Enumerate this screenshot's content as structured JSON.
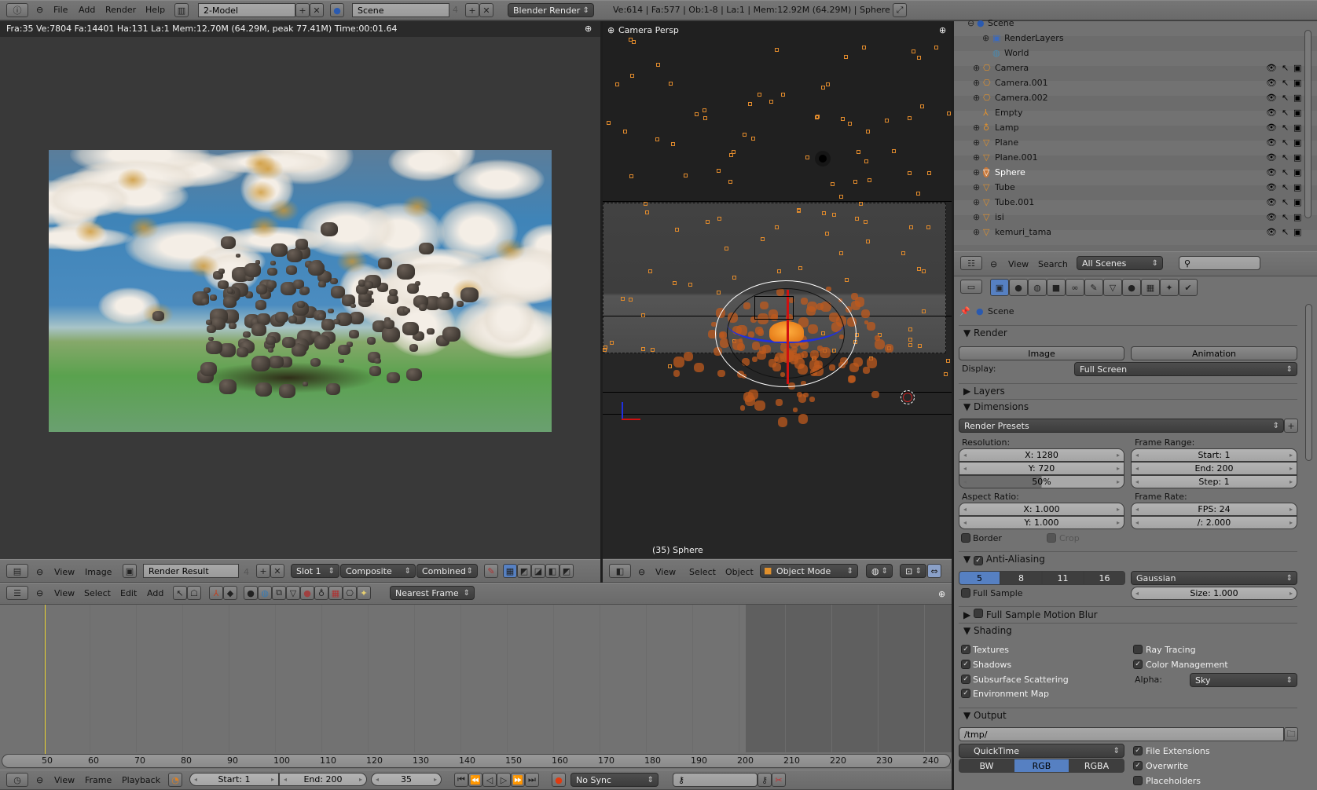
{
  "topbar": {
    "menus": [
      "File",
      "Add",
      "Render",
      "Help"
    ],
    "screen_layout": "2-Model",
    "scene": "Scene",
    "scene_users": "4",
    "engine": "Blender Render",
    "stats": "Ve:614 | Fa:577 | Ob:1-8 | La:1 | Mem:12.92M (64.29M) | Sphere"
  },
  "image_editor": {
    "info": "Fra:35  Ve:7804 Fa:14401 Ha:131 La:1 Mem:12.70M (64.29M, peak 77.41M) Time:00:01.64",
    "header": {
      "menus": [
        "View",
        "Image"
      ],
      "image_name": "Render Result",
      "image_users": "4",
      "slot": "Slot 1",
      "layer": "Composite",
      "pass": "Combined"
    }
  },
  "viewport": {
    "label": "Camera Persp",
    "object_label": "(35) Sphere",
    "header": {
      "menus": [
        "View",
        "Select",
        "Object"
      ],
      "mode": "Object Mode"
    },
    "colors": {
      "particle": "#e08a2c",
      "x_axis": "#d01010",
      "z_axis": "#2030e0"
    }
  },
  "outliner": {
    "items": [
      {
        "name": "Scene",
        "icon": "scene-icon",
        "expand": "collapse"
      },
      {
        "name": "RenderLayers",
        "icon": "renderlayers-icon",
        "expand": "expand"
      },
      {
        "name": "World",
        "icon": "world-icon",
        "expand": ""
      },
      {
        "name": "Camera",
        "icon": "camera-icon",
        "expand": "expand"
      },
      {
        "name": "Camera.001",
        "icon": "camera-icon",
        "expand": "expand"
      },
      {
        "name": "Camera.002",
        "icon": "camera-icon",
        "expand": "expand"
      },
      {
        "name": "Empty",
        "icon": "empty-icon",
        "expand": ""
      },
      {
        "name": "Lamp",
        "icon": "lamp-icon",
        "expand": "expand"
      },
      {
        "name": "Plane",
        "icon": "mesh-icon",
        "expand": "expand"
      },
      {
        "name": "Plane.001",
        "icon": "mesh-icon",
        "expand": "expand"
      },
      {
        "name": "Sphere",
        "icon": "mesh-icon",
        "expand": "expand",
        "selected": true
      },
      {
        "name": "Tube",
        "icon": "mesh-icon",
        "expand": "expand"
      },
      {
        "name": "Tube.001",
        "icon": "mesh-icon",
        "expand": "expand"
      },
      {
        "name": "isi",
        "icon": "mesh-icon",
        "expand": "expand"
      },
      {
        "name": "kemuri_tama",
        "icon": "mesh-icon",
        "expand": "expand"
      }
    ],
    "header": {
      "menus": [
        "View",
        "Search"
      ],
      "filter": "All Scenes",
      "search_placeholder": ""
    }
  },
  "properties": {
    "context": "Scene",
    "render": {
      "title": "Render",
      "image": "Image",
      "animation": "Animation",
      "display_label": "Display:",
      "display": "Full Screen"
    },
    "layers": {
      "title": "Layers"
    },
    "dimensions": {
      "title": "Dimensions",
      "presets": "Render Presets",
      "resolution_label": "Resolution:",
      "res_x": "X: 1280",
      "res_y": "Y: 720",
      "res_pct": "50%",
      "res_pct_value": 50,
      "frame_range_label": "Frame Range:",
      "start": "Start: 1",
      "end": "End: 200",
      "step": "Step: 1",
      "aspect_label": "Aspect Ratio:",
      "aspect_x": "X: 1.000",
      "aspect_y": "Y: 1.000",
      "frame_rate_label": "Frame Rate:",
      "fps": "FPS: 24",
      "fps_base": "/: 2.000",
      "border": "Border",
      "crop": "Crop"
    },
    "antialiasing": {
      "title": "Anti-Aliasing",
      "samples": [
        "5",
        "8",
        "11",
        "16"
      ],
      "selected": "5",
      "filter": "Gaussian",
      "full_sample": "Full Sample",
      "size": "Size: 1.000"
    },
    "motion_blur": {
      "title": "Full Sample Motion Blur"
    },
    "shading": {
      "title": "Shading",
      "textures": "Textures",
      "shadows": "Shadows",
      "sss": "Subsurface Scattering",
      "envmap": "Environment Map",
      "raytracing": "Ray Tracing",
      "color_management": "Color Management",
      "alpha_label": "Alpha:",
      "alpha": "Sky"
    },
    "output": {
      "title": "Output",
      "path": "/tmp/",
      "format": "QuickTime",
      "modes": [
        "BW",
        "RGB",
        "RGBA"
      ],
      "selected_mode": "RGB",
      "file_extensions": "File Extensions",
      "overwrite": "Overwrite",
      "placeholders": "Placeholders"
    },
    "accent": "#5680c2"
  },
  "dopesheet": {
    "menus": [
      "View",
      "Select",
      "Edit",
      "Add"
    ],
    "snap": "Nearest Frame"
  },
  "timeline": {
    "ticks": [
      "50",
      "60",
      "70",
      "80",
      "90",
      "100",
      "110",
      "120",
      "130",
      "140",
      "150",
      "160",
      "170",
      "180",
      "190",
      "200",
      "210",
      "220",
      "230",
      "240"
    ],
    "menus": [
      "View",
      "Frame",
      "Playback"
    ],
    "start": "Start: 1",
    "end": "End: 200",
    "current": "35",
    "sync": "No Sync"
  }
}
